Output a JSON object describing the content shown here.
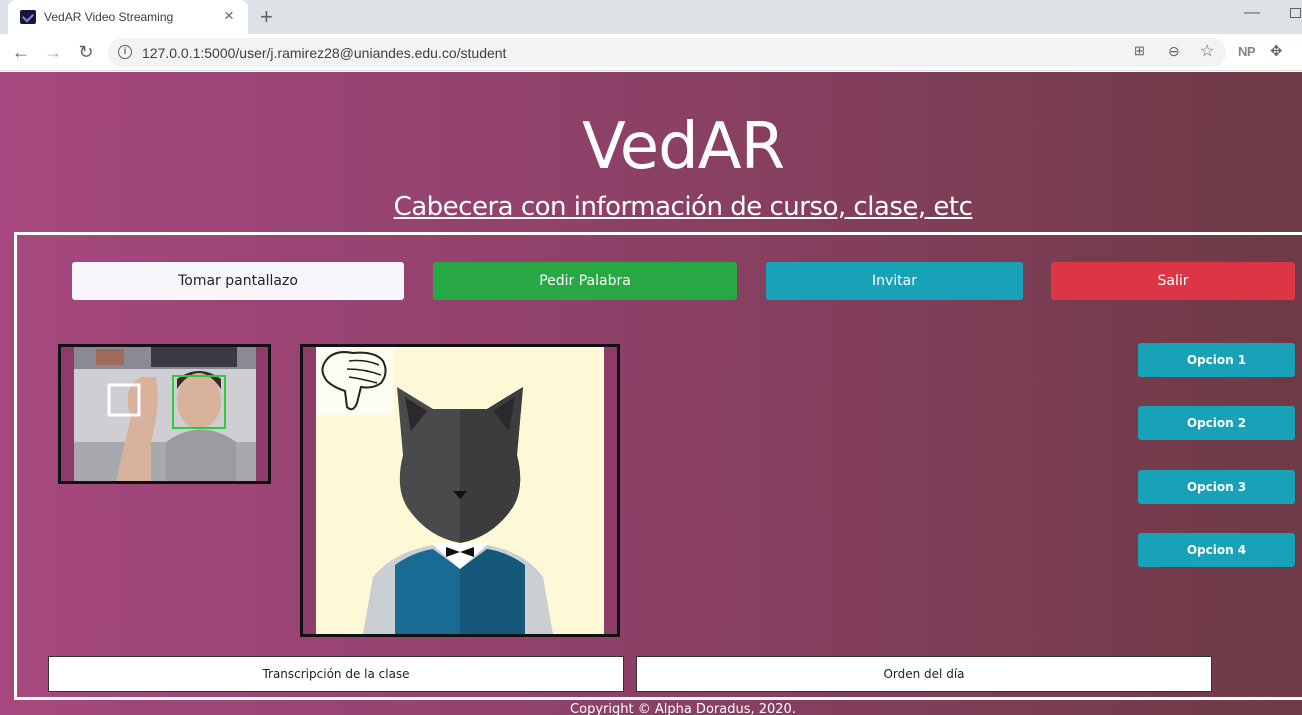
{
  "browser": {
    "tab_title": "VedAR Video Streaming",
    "tab_close": "×",
    "new_tab": "+",
    "url": "127.0.0.1:5000/user/j.ramirez28@uniandes.edu.co/student",
    "extension_np": "NP"
  },
  "header": {
    "title": "VedAR",
    "subtitle": "Cabecera con información de curso, clase, etc"
  },
  "actions": {
    "screenshot": "Tomar pantallazo",
    "request_word": "Pedir Palabra",
    "invite": "Invitar",
    "exit": "Salir"
  },
  "options": [
    "Opcion 1",
    "Opcion 2",
    "Opcion 3",
    "Opcion 4"
  ],
  "fields": {
    "transcription": "Transcripción de la clase",
    "agenda": "Orden del día"
  },
  "footer": {
    "copyright": "Copyright © Alpha Doradus, 2020."
  },
  "colors": {
    "gradient_start": "#a6487f",
    "gradient_end": "#6e3a45",
    "success": "#28a745",
    "info": "#17a2b8",
    "danger": "#dc3545"
  }
}
